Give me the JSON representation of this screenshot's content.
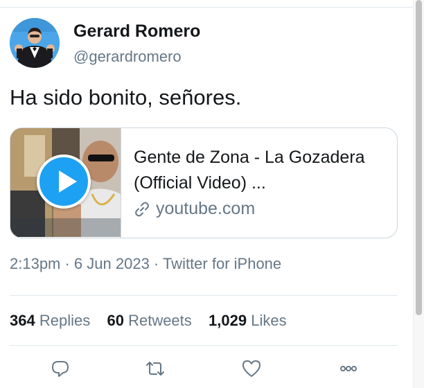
{
  "author": {
    "name": "Gerard Romero",
    "handle": "@gerardromero",
    "avatar_icon": "profile-photo"
  },
  "tweet": {
    "text": "Ha sido bonito, señores.",
    "timestamp": "2:13pm · 6 Jun 2023 · Twitter for iPhone"
  },
  "card": {
    "title": "Gente de Zona - La Gozadera (Official Video) ...",
    "domain": "youtube.com",
    "play_icon": "play-icon",
    "link_icon": "link-icon"
  },
  "stats": {
    "replies_count": "364",
    "replies_label": "Replies",
    "retweets_count": "60",
    "retweets_label": "Retweets",
    "likes_count": "1,029",
    "likes_label": "Likes"
  },
  "actions": [
    "reply-icon",
    "retweet-icon",
    "like-icon",
    "more-icon"
  ],
  "colors": {
    "accent": "#1da1f2",
    "text_primary": "#14171a",
    "text_secondary": "#657786",
    "border": "#ccd6dd"
  }
}
